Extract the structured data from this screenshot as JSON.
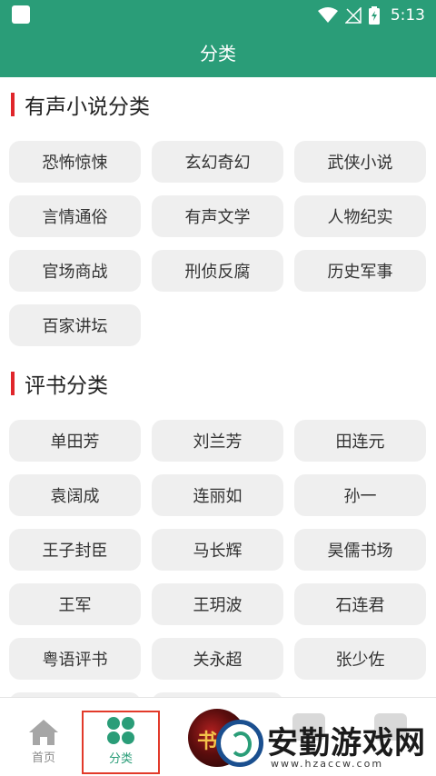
{
  "status_bar": {
    "time": "5:13"
  },
  "header": {
    "title": "分类"
  },
  "sections": [
    {
      "title": "有声小说分类",
      "items": [
        "恐怖惊悚",
        "玄幻奇幻",
        "武侠小说",
        "言情通俗",
        "有声文学",
        "人物纪实",
        "官场商战",
        "刑侦反腐",
        "历史军事",
        "百家讲坛"
      ]
    },
    {
      "title": "评书分类",
      "items": [
        "单田芳",
        "刘兰芳",
        "田连元",
        "袁阔成",
        "连丽如",
        "孙一",
        "王子封臣",
        "马长辉",
        "昊儒书场",
        "王军",
        "王玥波",
        "石连君",
        "粤语评书",
        "关永超",
        "张少佐"
      ]
    }
  ],
  "bottom_nav": {
    "items": [
      {
        "label": "首页",
        "icon": "home-icon",
        "active": false
      },
      {
        "label": "分类",
        "icon": "grid-icon",
        "active": true
      }
    ]
  },
  "watermark": {
    "text": "安勤游戏网",
    "url": "www.hzaccw.com"
  },
  "colors": {
    "primary": "#2a9d78",
    "accent": "#e0262b",
    "chip_bg": "#efefef"
  }
}
